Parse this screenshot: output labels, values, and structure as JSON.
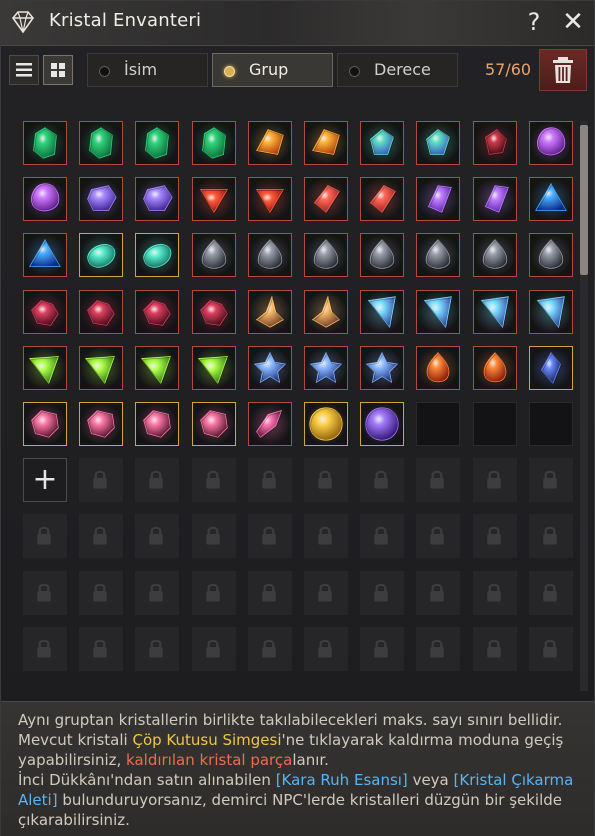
{
  "window": {
    "title": "Kristal Envanteri",
    "help_label": "?",
    "close_label": "✕"
  },
  "toolbar": {
    "view_list_icon": "list-view-icon",
    "view_grid_icon": "grid-view-icon",
    "sort_options": [
      {
        "label": "İsim",
        "selected": false
      },
      {
        "label": "Grup",
        "selected": true
      },
      {
        "label": "Derece",
        "selected": false
      }
    ],
    "slot_count": "57/60",
    "trash_icon": "trash-icon"
  },
  "inventory": {
    "rows": [
      [
        "green",
        "green",
        "green",
        "green",
        "orange",
        "orange",
        "green-blue",
        "green-blue",
        "dark-red",
        "purple-round"
      ],
      [
        "purple-round",
        "purple-hex",
        "purple-hex",
        "red-tri",
        "red-tri",
        "red-shard",
        "red-shard",
        "purple-shard",
        "purple-shard",
        "blue-tri"
      ],
      [
        "blue-tri",
        "teal-oval",
        "teal-oval",
        "gray-drop",
        "gray-drop",
        "gray-drop",
        "gray-drop",
        "gray-drop",
        "gray-drop",
        "gray-drop"
      ],
      [
        "crimson-cluster",
        "crimson-cluster",
        "crimson-cluster",
        "crimson-cluster",
        "amber-drop",
        "amber-drop",
        "cyan-kite",
        "cyan-kite",
        "cyan-kite",
        "cyan-kite"
      ],
      [
        "lime-kite",
        "lime-kite",
        "lime-kite",
        "lime-kite",
        "blue-star",
        "blue-star",
        "blue-star",
        "fire-drop",
        "fire-drop",
        "navy-kite"
      ],
      [
        "pink-gem",
        "pink-gem",
        "pink-gem",
        "pink-gem",
        "pink-shard",
        "gold-orb",
        "violet-orb",
        "empty",
        "empty",
        "empty"
      ]
    ],
    "gold_border_slots": [
      [
        2,
        1
      ],
      [
        2,
        2
      ],
      [
        4,
        9
      ],
      [
        5,
        0
      ],
      [
        5,
        1
      ],
      [
        5,
        2
      ],
      [
        5,
        3
      ],
      [
        5,
        5
      ],
      [
        5,
        6
      ]
    ],
    "add_slot_label": "+",
    "locked_rows": 4
  },
  "info": {
    "line1": "Aynı gruptan kristallerin birlikte takılabilecekleri maks. sayı sınırı bellidir.",
    "p2a": "Mevcut kristali ",
    "p2b": "Çöp Kutusu Simgesi",
    "p2c": "'ne tıklayarak kaldırma moduna geçiş yapabilirsiniz, ",
    "p2d": "kaldırılan kristal parça",
    "p2e": "lanır.",
    "p3a": "İnci Dükkânı'ndan satın alınabilen ",
    "p3b": "[Kara Ruh Esansı]",
    "p3c": " veya ",
    "p3d": "[Kristal Çıkarma Aleti]",
    "p3e": " bulunduruyorsanız, demirci NPC'lerde kristalleri düzgün bir şekilde çıkarabilirsiniz."
  },
  "colors": {
    "accent_gold": "#d7b055",
    "count_orange": "#e9a46b",
    "highlight_yellow": "#f0c44a",
    "highlight_red": "#ef6b4e",
    "highlight_blue": "#58b4f3"
  }
}
